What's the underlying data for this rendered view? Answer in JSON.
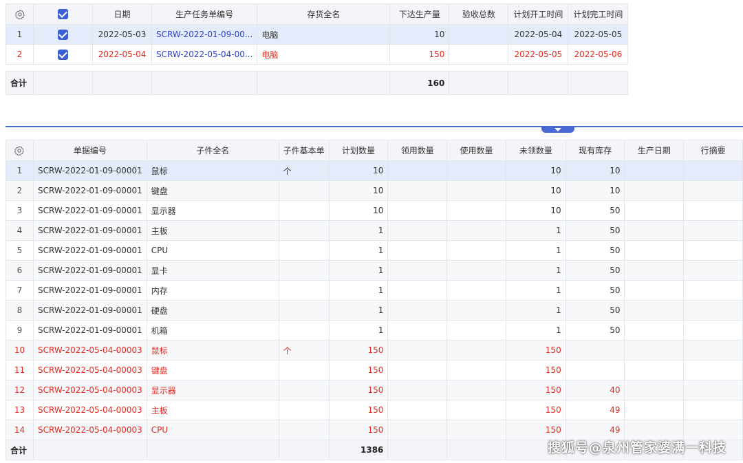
{
  "top": {
    "headers": [
      "日期",
      "生产任务单编号",
      "存货全名",
      "下达生产量",
      "验收总数",
      "计划开工时间",
      "计划完工时间"
    ],
    "rows": [
      {
        "idx": "1",
        "date": "2022-05-03",
        "code": "SCRW-2022-01-09-00...",
        "name": "电脑",
        "qty": "10",
        "accepted": "",
        "start": "2022-05-04",
        "end": "2022-05-05"
      },
      {
        "idx": "2",
        "date": "2022-05-04",
        "code": "SCRW-2022-05-04-00...",
        "name": "电脑",
        "qty": "150",
        "accepted": "",
        "start": "2022-05-05",
        "end": "2022-05-06"
      }
    ],
    "total_label": "合计",
    "total_qty": "160"
  },
  "bottom": {
    "headers": [
      "单据编号",
      "子件全名",
      "子件基本单",
      "计划数量",
      "领用数量",
      "使用数量",
      "未领数量",
      "现有库存",
      "生产日期",
      "行摘要"
    ],
    "rows": [
      {
        "idx": "1",
        "code": "SCRW-2022-01-09-00001",
        "name": "鼠标",
        "unit": "个",
        "plan": "10",
        "taken": "",
        "used": "",
        "untaken": "10",
        "stock": "10"
      },
      {
        "idx": "2",
        "code": "SCRW-2022-01-09-00001",
        "name": "键盘",
        "unit": "",
        "plan": "10",
        "taken": "",
        "used": "",
        "untaken": "10",
        "stock": "10"
      },
      {
        "idx": "3",
        "code": "SCRW-2022-01-09-00001",
        "name": "显示器",
        "unit": "",
        "plan": "10",
        "taken": "",
        "used": "",
        "untaken": "10",
        "stock": "50"
      },
      {
        "idx": "4",
        "code": "SCRW-2022-01-09-00001",
        "name": "主板",
        "unit": "",
        "plan": "1",
        "taken": "",
        "used": "",
        "untaken": "1",
        "stock": "50"
      },
      {
        "idx": "5",
        "code": "SCRW-2022-01-09-00001",
        "name": "CPU",
        "unit": "",
        "plan": "1",
        "taken": "",
        "used": "",
        "untaken": "1",
        "stock": "50"
      },
      {
        "idx": "6",
        "code": "SCRW-2022-01-09-00001",
        "name": "显卡",
        "unit": "",
        "plan": "1",
        "taken": "",
        "used": "",
        "untaken": "1",
        "stock": "50"
      },
      {
        "idx": "7",
        "code": "SCRW-2022-01-09-00001",
        "name": "内存",
        "unit": "",
        "plan": "1",
        "taken": "",
        "used": "",
        "untaken": "1",
        "stock": "50"
      },
      {
        "idx": "8",
        "code": "SCRW-2022-01-09-00001",
        "name": "硬盘",
        "unit": "",
        "plan": "1",
        "taken": "",
        "used": "",
        "untaken": "1",
        "stock": "50"
      },
      {
        "idx": "9",
        "code": "SCRW-2022-01-09-00001",
        "name": "机箱",
        "unit": "",
        "plan": "1",
        "taken": "",
        "used": "",
        "untaken": "1",
        "stock": "50"
      },
      {
        "idx": "10",
        "code": "SCRW-2022-05-04-00003",
        "name": "鼠标",
        "unit": "个",
        "plan": "150",
        "taken": "",
        "used": "",
        "untaken": "150",
        "stock": ""
      },
      {
        "idx": "11",
        "code": "SCRW-2022-05-04-00003",
        "name": "键盘",
        "unit": "",
        "plan": "150",
        "taken": "",
        "used": "",
        "untaken": "150",
        "stock": ""
      },
      {
        "idx": "12",
        "code": "SCRW-2022-05-04-00003",
        "name": "显示器",
        "unit": "",
        "plan": "150",
        "taken": "",
        "used": "",
        "untaken": "150",
        "stock": "40"
      },
      {
        "idx": "13",
        "code": "SCRW-2022-05-04-00003",
        "name": "主板",
        "unit": "",
        "plan": "150",
        "taken": "",
        "used": "",
        "untaken": "150",
        "stock": "49"
      },
      {
        "idx": "14",
        "code": "SCRW-2022-05-04-00003",
        "name": "CPU",
        "unit": "",
        "plan": "150",
        "taken": "",
        "used": "",
        "untaken": "150",
        "stock": "49"
      }
    ],
    "total_label": "合计",
    "total_plan": "1386"
  },
  "watermark": "搜狐号@泉州管家婆满一科技",
  "colors": {
    "accent": "#3d5fd6",
    "red_text": "#e6281e",
    "link_blue": "#2b3fc7",
    "selected_row": "#e4ecfb"
  }
}
